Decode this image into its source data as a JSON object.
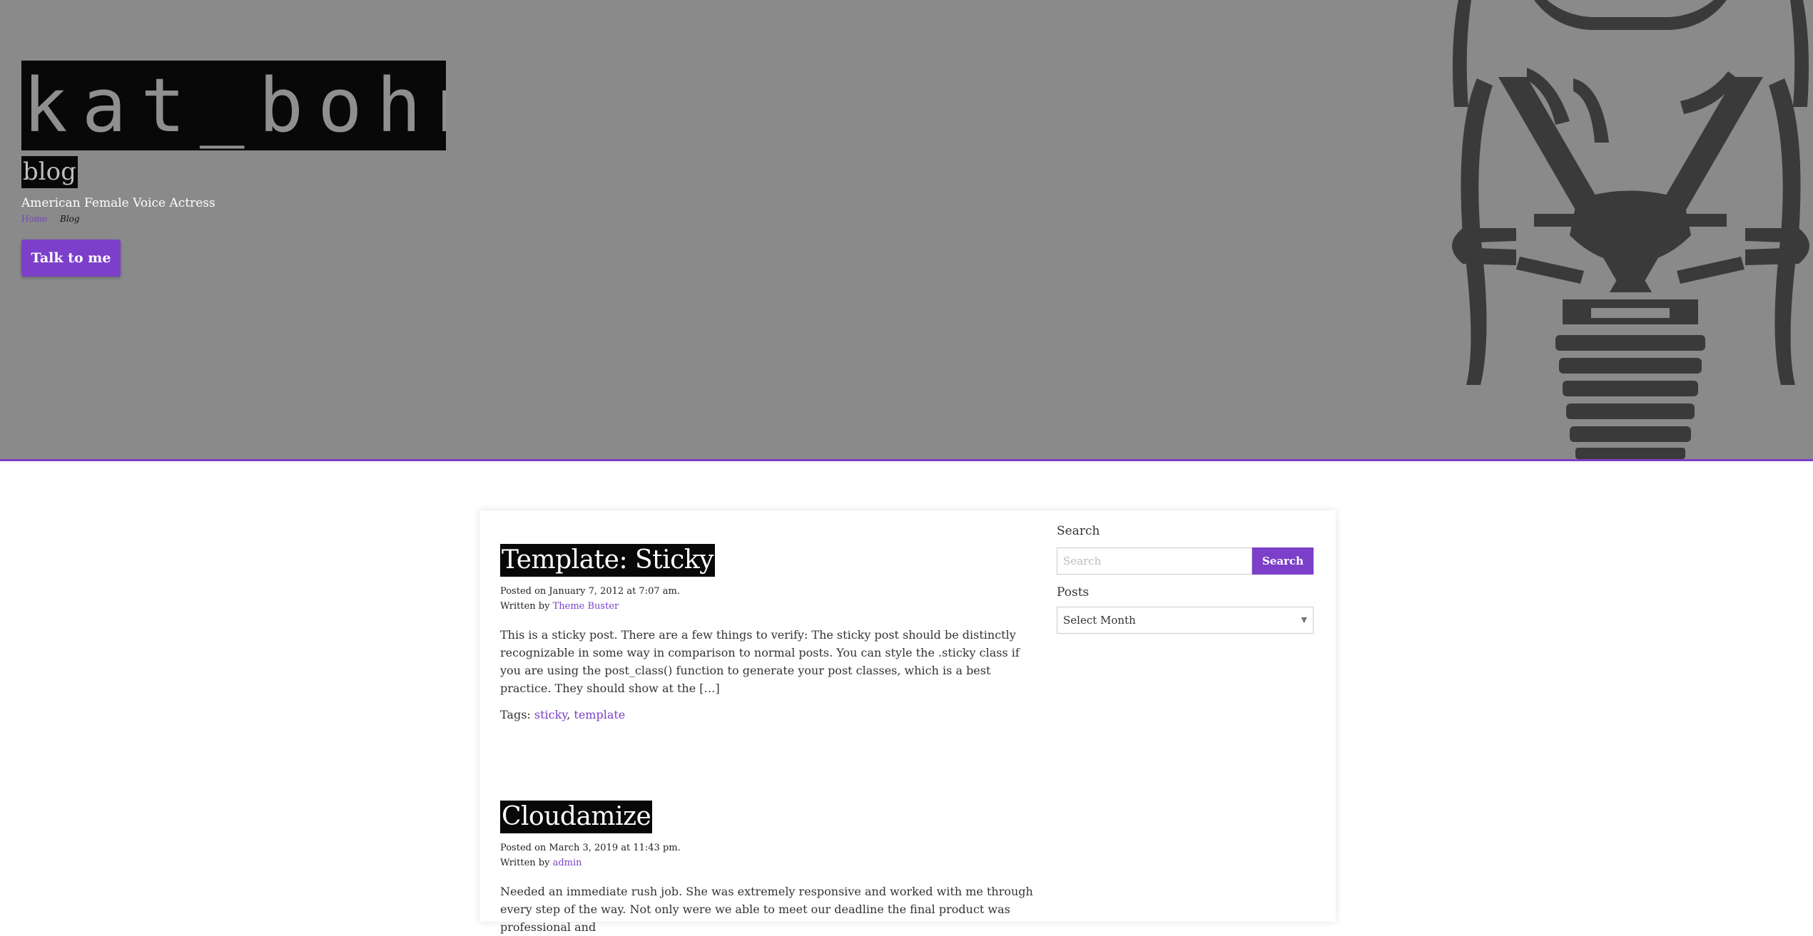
{
  "header": {
    "logo_text": "kat_bohn",
    "page_label": "blog",
    "tagline": "American Female Voice Actress",
    "breadcrumb": {
      "home": "Home",
      "current": "Blog"
    },
    "cta_label": "Talk to me"
  },
  "posts": [
    {
      "title": "Template: Sticky",
      "posted": "Posted on January 7, 2012 at 7:07 am.",
      "written_by": "Written by",
      "author": "Theme Buster",
      "excerpt": "This is a sticky post. There are a few things to verify: The sticky post should be distinctly recognizable in some way in comparison to normal posts. You can style the .sticky class if you are using the post_class() function to generate your post classes, which is a best practice. They should show at the […]",
      "tags_label": "Tags:",
      "tags": [
        "sticky",
        "template"
      ]
    },
    {
      "title": "Cloudamize",
      "posted": "Posted on March 3, 2019 at 11:43 pm.",
      "written_by": "Written by",
      "author": "admin",
      "excerpt": "Needed an immediate rush job. She was extremely responsive and worked with me through every step of the way. Not only were we able to meet our deadline the final product was professional and"
    }
  ],
  "sidebar": {
    "search_title": "Search",
    "search_placeholder": "Search",
    "search_button": "Search",
    "posts_title": "Posts",
    "archive_selected": "Select Month"
  },
  "colors": {
    "accent": "#7b3fc9",
    "header_bg": "#8a8a8a",
    "mic": "#3a3a3a"
  }
}
